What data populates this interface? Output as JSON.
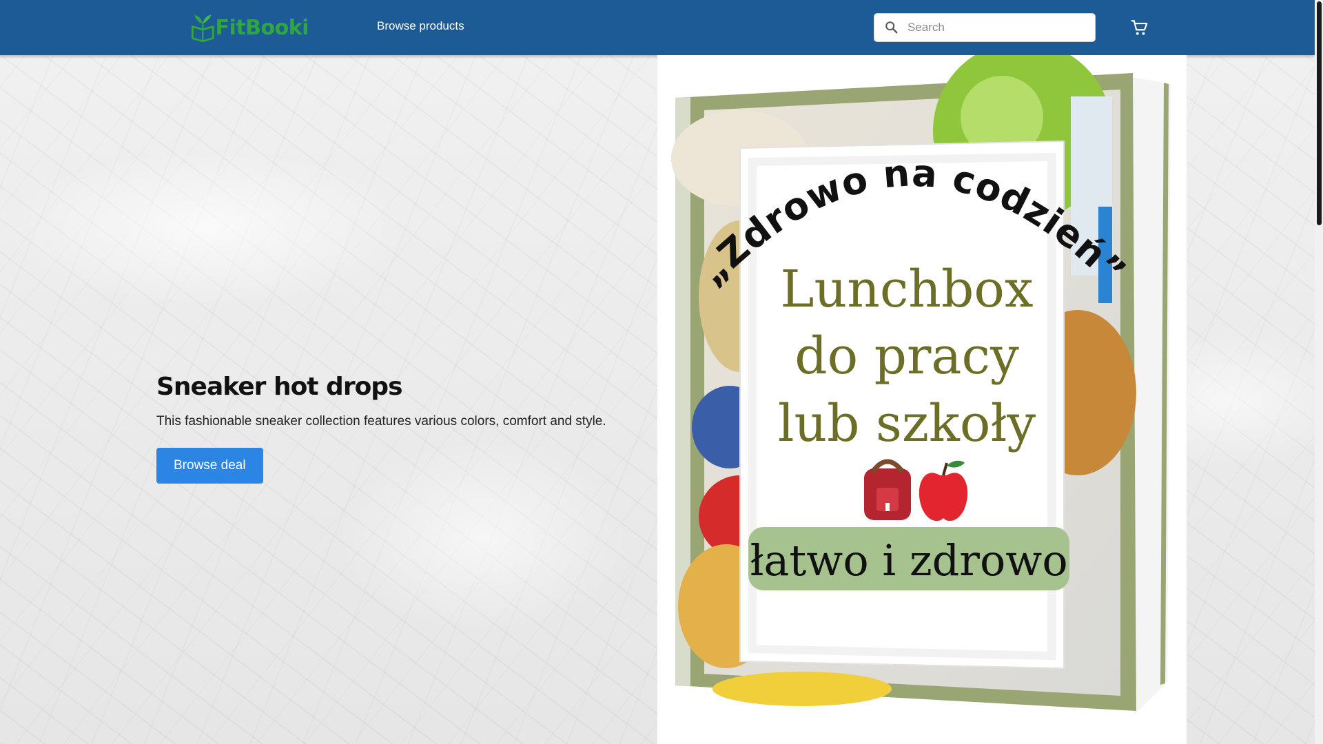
{
  "header": {
    "logo_text": "FitBooki",
    "nav": {
      "browse_products": "Browse products"
    },
    "search": {
      "placeholder": "Search",
      "value": ""
    },
    "colors": {
      "bar": "#1d5b96",
      "logo_green": "#2ea83c"
    }
  },
  "hero": {
    "title": "Sneaker hot drops",
    "description": "This fashionable sneaker collection features various colors, comfort and style.",
    "button_label": "Browse deal",
    "button_color": "#2c85e3"
  },
  "product_image": {
    "arc_text": "„Zdrowo na codzień”",
    "lines": [
      "Lunchbox",
      "do pracy",
      "lub szkoły"
    ],
    "tagline": "łatwo i zdrowo",
    "colors": {
      "frame": "#9aa574",
      "title_green": "#6b6e24",
      "tagline_bg": "#a6c28f"
    }
  },
  "icons": {
    "search": "search-icon",
    "cart": "cart-icon",
    "logo": "book-sprout-icon"
  }
}
